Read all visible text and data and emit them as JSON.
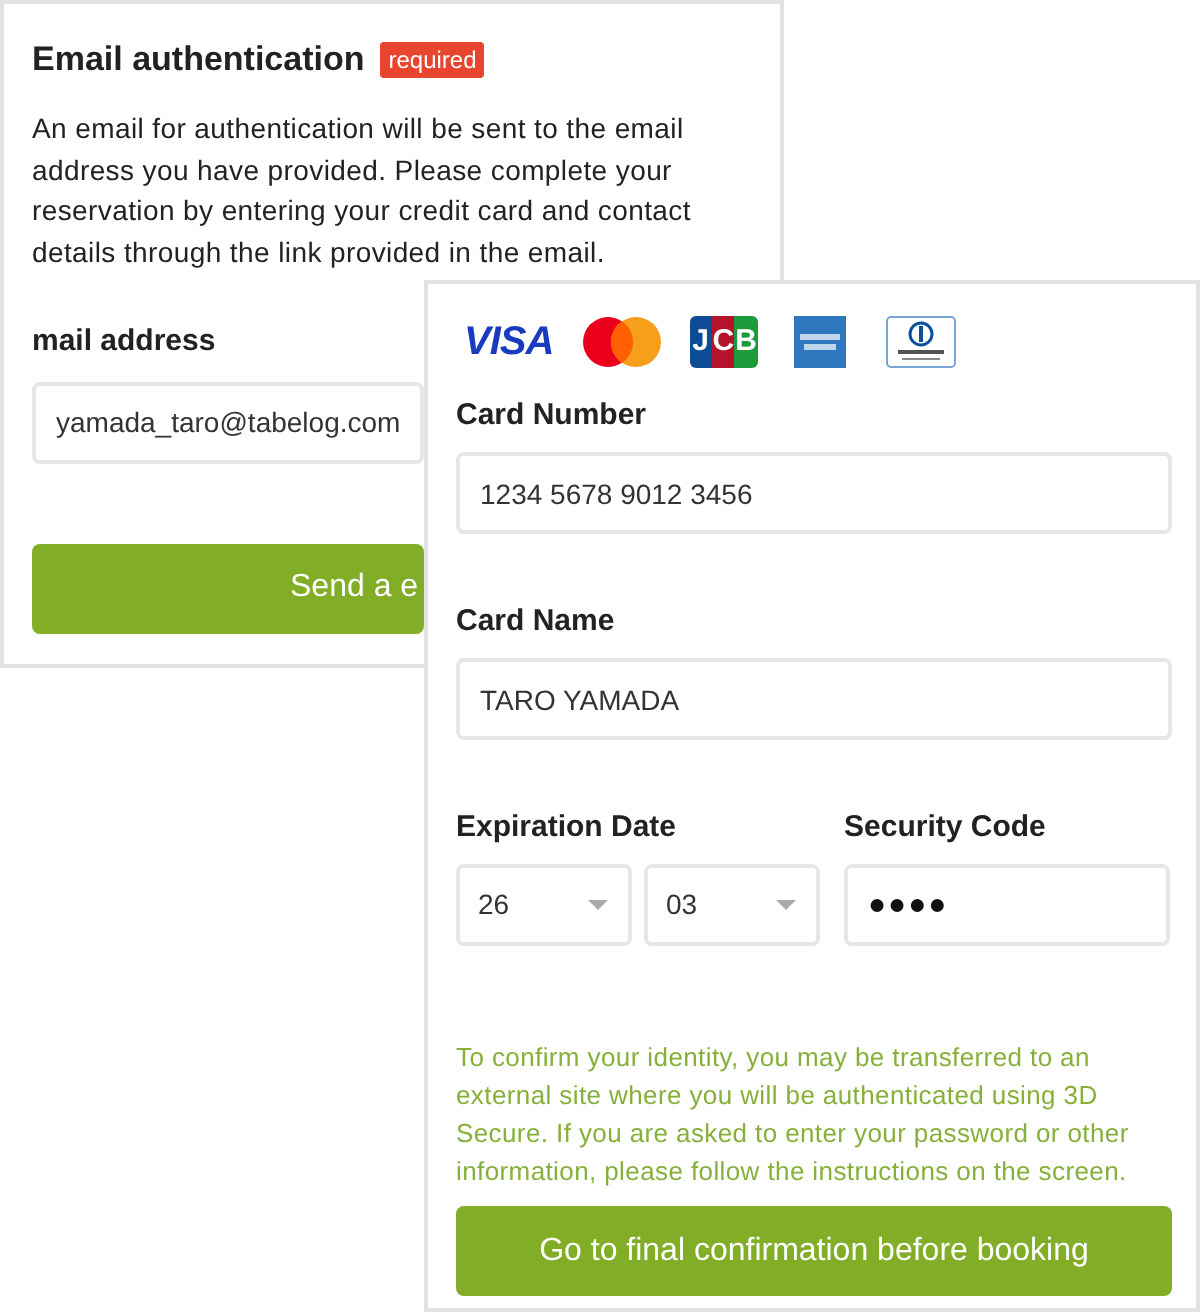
{
  "email_card": {
    "title": "Email authentication",
    "badge": "required",
    "description": "An email for authentication will be sent to the email address you have provided. Please complete your reservation by entering your credit card and contact details through the link provided in the email.",
    "field": {
      "label": "mail address",
      "value": "yamada_taro@tabelog.com"
    },
    "button": "Send a e"
  },
  "card_form": {
    "brands": [
      {
        "kind": "visa",
        "label": "VISA"
      },
      {
        "kind": "mastercard"
      },
      {
        "kind": "jcb",
        "label": "JCB"
      },
      {
        "kind": "amex"
      },
      {
        "kind": "diners"
      }
    ],
    "card_number": {
      "label": "Card Number",
      "value": "1234 5678 9012 3456"
    },
    "card_name": {
      "label": "Card Name",
      "value": "TARO YAMADA"
    },
    "expiration": {
      "label": "Expiration Date",
      "year": "26",
      "month": "03"
    },
    "security_code": {
      "label": "Security Code",
      "value": "●●●●"
    },
    "note": "To confirm your identity, you may be transferred to an external site where you will be authenticated using 3D Secure. If you are asked to enter your password or other information, please follow the instructions on the screen.",
    "button": "Go to final confirmation before booking"
  }
}
